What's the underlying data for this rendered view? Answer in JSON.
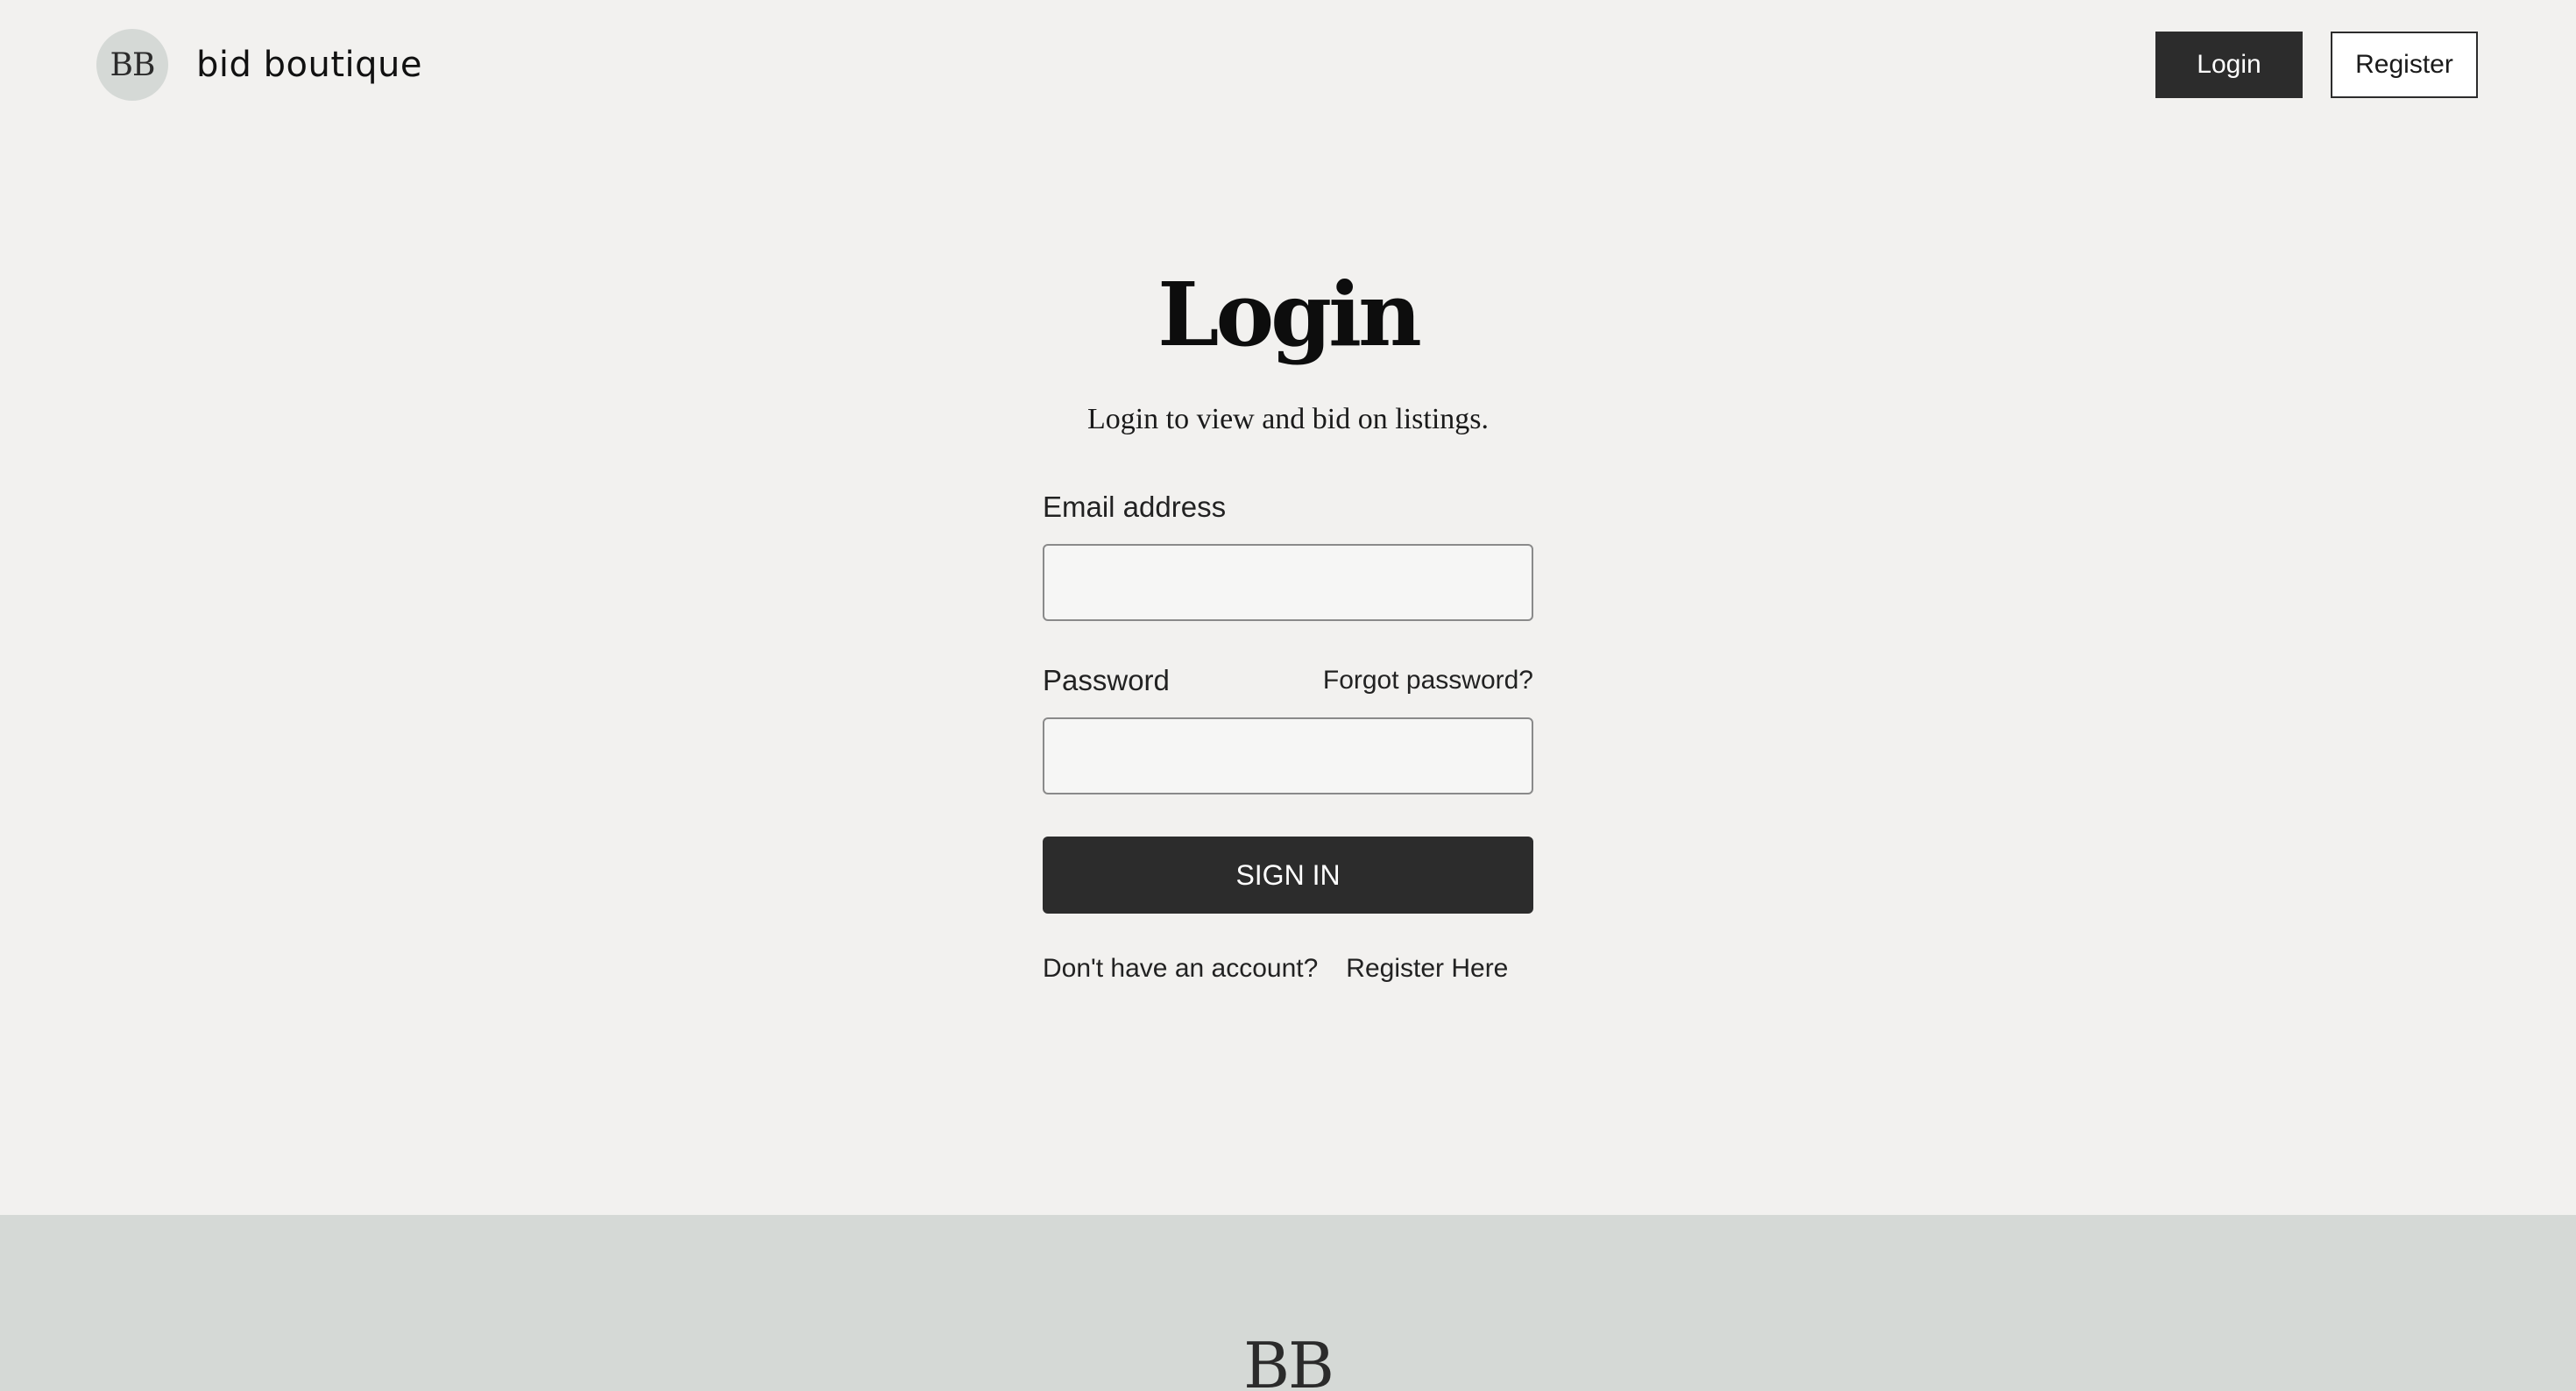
{
  "header": {
    "logo_text": "BB",
    "brand_name": "bid boutique",
    "login_label": "Login",
    "register_label": "Register"
  },
  "main": {
    "title": "Login",
    "subtitle": "Login to view and bid on listings.",
    "email": {
      "label": "Email address",
      "value": "",
      "placeholder": ""
    },
    "password": {
      "label": "Password",
      "value": "",
      "placeholder": "",
      "forgot_label": "Forgot password?"
    },
    "signin_label": "SIGN IN",
    "register_prompt": "Don't have an account?",
    "register_link_label": "Register Here"
  },
  "footer": {
    "logo_text": "BB"
  },
  "colors": {
    "background": "#f2f1ef",
    "footer_background": "#d5d9d6",
    "primary_button": "#2c2c2c",
    "logo_circle": "#d5d9d6"
  }
}
